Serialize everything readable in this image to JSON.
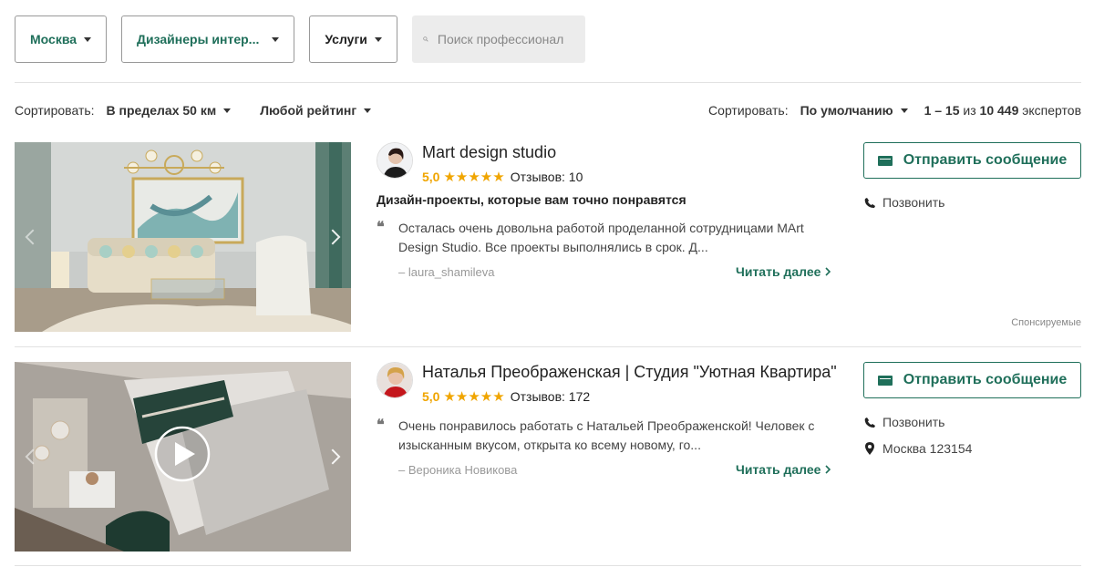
{
  "filters": {
    "city": "Москва",
    "category": "Дизайнеры интер...",
    "services": "Услуги",
    "search_placeholder": "Поиск профессионал"
  },
  "sort_bar": {
    "left_label": "Сортировать:",
    "distance": "В пределах 50 км",
    "rating": "Любой рейтинг",
    "right_label": "Сортировать:",
    "order": "По умолчанию",
    "count_range": "1 – 15",
    "count_of": "из",
    "count_total": "10 449",
    "count_suffix": "экспертов"
  },
  "listings": [
    {
      "name": "Mart design studio",
      "score": "5,0",
      "stars": "★★★★★",
      "reviews": "Отзывов: 10",
      "tagline": "Дизайн-проекты, которые вам точно понравятся",
      "quote_mark": "❝",
      "review": "Осталась очень довольна работой проделанной сотрудницами MArt Design Studio. Все проекты выполнялись в срок. Д...",
      "author": "– laura_shamileva",
      "read_more": "Читать далее",
      "message_button": "Отправить сообщение",
      "call": "Позвонить",
      "sponsored": "Спонсируемые"
    },
    {
      "name": "Наталья Преображенская | Студия \"Уютная Квартира\"",
      "score": "5,0",
      "stars": "★★★★★",
      "reviews": "Отзывов: 172",
      "quote_mark": "❝",
      "review": "Очень понравилось работать с Натальей Преображенской! Человек с изысканным вкусом, открыта ко всему новому, го...",
      "author": "– Вероника Новикова",
      "read_more": "Читать далее",
      "message_button": "Отправить сообщение",
      "call": "Позвонить",
      "location": "Москва 123154"
    }
  ],
  "colors": {
    "accent": "#1f6f5a",
    "star": "#f0a500"
  }
}
